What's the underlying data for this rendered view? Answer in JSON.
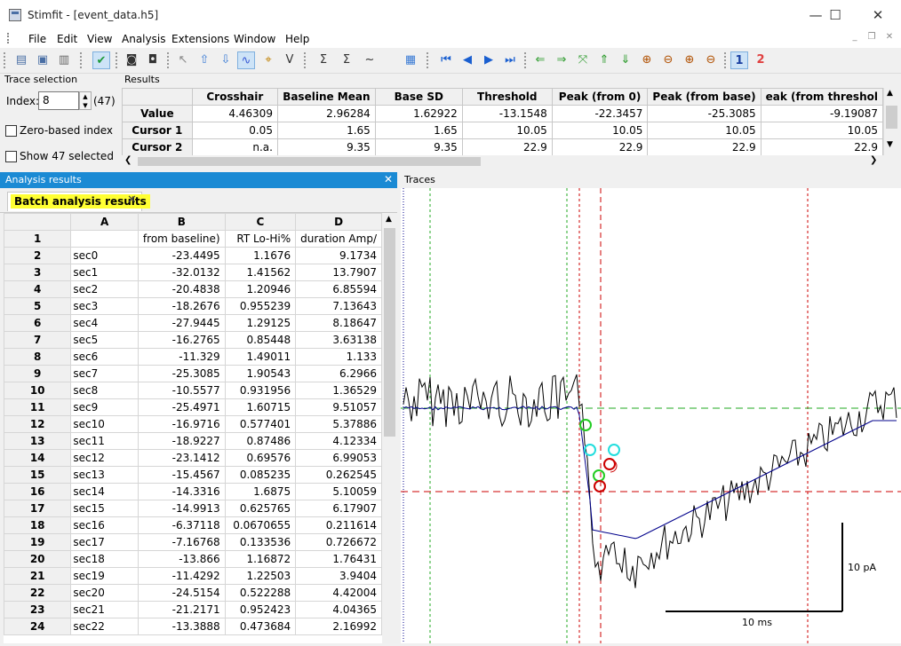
{
  "window": {
    "title": "Stimfit - [event_data.h5]",
    "min": "—",
    "max": "☐",
    "close": "✕"
  },
  "menu": [
    "File",
    "Edit",
    "View",
    "Analysis",
    "Extensions",
    "Window",
    "Help"
  ],
  "mdi": {
    "min": "_",
    "restore": "❐",
    "close": "✕"
  },
  "toolbar": {
    "icons": [
      "open-icon",
      "save-icon",
      "print-icon",
      "apply-icon",
      "camera-icon",
      "camera-ps-icon",
      "cursor-arrow-icon",
      "trace-up-icon",
      "trace-down-icon",
      "fit-icon",
      "zoom-icon",
      "v-icon",
      "sum-icon",
      "sum-avg-icon",
      "wave-icon",
      "table-icon",
      "first-icon",
      "prev-icon",
      "next-icon",
      "last-icon",
      "left-arrow-icon",
      "right-arrow-icon",
      "fit-window-icon",
      "up-arrow-icon",
      "down-arrow-icon",
      "zoom-in-x-icon",
      "zoom-out-x-icon",
      "zoom-in-y-icon",
      "zoom-out-y-icon",
      "channel1-icon",
      "channel2-icon"
    ],
    "channel1": "1",
    "channel2": "2"
  },
  "trace_selection": {
    "title": "Trace selection",
    "index_label": "Index:",
    "index_value": "8",
    "count": "(47)",
    "zero_based": "Zero-based index",
    "show_selected": "Show  47 selected"
  },
  "results": {
    "title": "Results",
    "columns": [
      "",
      "Crosshair",
      "Baseline Mean",
      "Base SD",
      "Threshold",
      "Peak (from 0)",
      "Peak (from base)",
      "eak (from threshol"
    ],
    "rows": [
      {
        "label": "Value",
        "cells": [
          "4.46309",
          "2.96284",
          "1.62922",
          "-13.1548",
          "-22.3457",
          "-25.3085",
          "-9.19087"
        ]
      },
      {
        "label": "Cursor 1",
        "cells": [
          "0.05",
          "1.65",
          "1.65",
          "10.05",
          "10.05",
          "10.05",
          "10.05"
        ]
      },
      {
        "label": "Cursor 2",
        "cells": [
          "n.a.",
          "9.35",
          "9.35",
          "22.9",
          "22.9",
          "22.9",
          "22.9"
        ]
      }
    ]
  },
  "analysis": {
    "title": "Analysis results",
    "tab": "Batch analysis results",
    "columns": [
      "",
      "A",
      "B",
      "C",
      "D"
    ],
    "rows": [
      [
        "1",
        "",
        "from baseline)",
        "RT Lo-Hi%",
        "duration Amp/"
      ],
      [
        "2",
        "sec0",
        "-23.4495",
        "1.1676",
        "9.1734"
      ],
      [
        "3",
        "sec1",
        "-32.0132",
        "1.41562",
        "13.7907"
      ],
      [
        "4",
        "sec2",
        "-20.4838",
        "1.20946",
        "6.85594"
      ],
      [
        "5",
        "sec3",
        "-18.2676",
        "0.955239",
        "7.13643"
      ],
      [
        "6",
        "sec4",
        "-27.9445",
        "1.29125",
        "8.18647"
      ],
      [
        "7",
        "sec5",
        "-16.2765",
        "0.85448",
        "3.63138"
      ],
      [
        "8",
        "sec6",
        "-11.329",
        "1.49011",
        "1.133"
      ],
      [
        "9",
        "sec7",
        "-25.3085",
        "1.90543",
        "6.2966"
      ],
      [
        "10",
        "sec8",
        "-10.5577",
        "0.931956",
        "1.36529"
      ],
      [
        "11",
        "sec9",
        "-25.4971",
        "1.60715",
        "9.51057"
      ],
      [
        "12",
        "sec10",
        "-16.9716",
        "0.577401",
        "5.37886"
      ],
      [
        "13",
        "sec11",
        "-18.9227",
        "0.87486",
        "4.12334"
      ],
      [
        "14",
        "sec12",
        "-23.1412",
        "0.69576",
        "6.99053"
      ],
      [
        "15",
        "sec13",
        "-15.4567",
        "0.085235",
        "0.262545"
      ],
      [
        "16",
        "sec14",
        "-14.3316",
        "1.6875",
        "5.10059"
      ],
      [
        "17",
        "sec15",
        "-14.9913",
        "0.625765",
        "6.17907"
      ],
      [
        "18",
        "sec16",
        "-6.37118",
        "0.0670655",
        "0.211614"
      ],
      [
        "19",
        "sec17",
        "-7.16768",
        "0.133536",
        "0.726672"
      ],
      [
        "20",
        "sec18",
        "-13.866",
        "1.16872",
        "1.76431"
      ],
      [
        "21",
        "sec19",
        "-11.4292",
        "1.22503",
        "3.9404"
      ],
      [
        "22",
        "sec20",
        "-24.5154",
        "0.522288",
        "4.42004"
      ],
      [
        "23",
        "sec21",
        "-21.2171",
        "0.952423",
        "4.04365"
      ],
      [
        "24",
        "sec22",
        "-13.3888",
        "0.473684",
        "2.16992"
      ]
    ]
  },
  "traces": {
    "title": "Traces",
    "scale_y": "10 pA",
    "scale_x": "10 ms",
    "colors": {
      "raw": "#000000",
      "avg": "#00008b",
      "baseline": "#22aa22",
      "peak": "#cc0000",
      "cursor1": "#22aa22",
      "cursor2": "#cc0000"
    }
  }
}
